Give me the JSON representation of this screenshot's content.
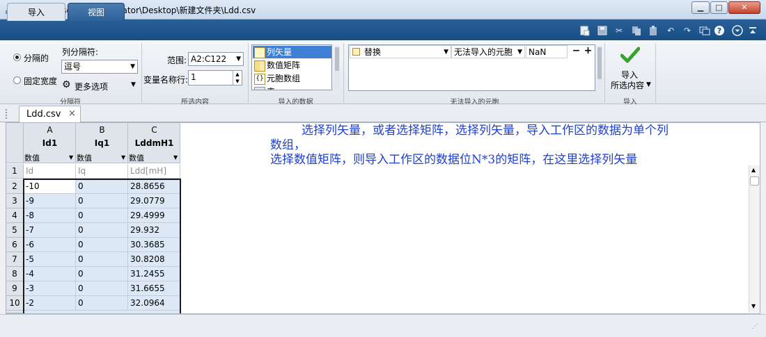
{
  "window": {
    "title": "导入 - C:\\Users\\Administrator\\Desktop\\新建文件夹\\Ldd.csv",
    "minimize_glyph": "▁",
    "maximize_glyph": "□",
    "close_glyph": "✕"
  },
  "tabs": [
    {
      "label": "导入",
      "active": true
    },
    {
      "label": "视图",
      "active": false
    }
  ],
  "quick_access_icons": [
    "new-icon",
    "save-icon",
    "cut-icon",
    "copy-icon",
    "paste-icon",
    "undo-icon",
    "redo-icon",
    "switch-windows-icon",
    "help-icon",
    "minimize-toolstrip-icon",
    "collapse-icon"
  ],
  "toolstrip": {
    "delimiters": {
      "radio_delimited": "分隔的",
      "radio_fixed_width": "固定宽度",
      "column_delimiter_label": "列分隔符:",
      "column_delimiter_value": "逗号",
      "more_options": "更多选项",
      "section_label": "分隔符"
    },
    "selection": {
      "range_label": "范围:",
      "range_value": "A2:C122",
      "var_names_row_label": "变量名称行:",
      "var_names_row_value": "1",
      "section_label": "所选内容"
    },
    "output_type": {
      "options": [
        "列矢量",
        "数值矩阵",
        "元胞数组",
        "表"
      ],
      "selected": "列矢量",
      "section_label": "导入的数据"
    },
    "unimportable": {
      "rule_action": "替换",
      "rule_target": "无法导入的元胞",
      "replacement_value": "NaN",
      "remove_glyph": "−",
      "add_glyph": "+",
      "section_label": "无法导入的元胞"
    },
    "import": {
      "button_line1": "导入",
      "button_line2": "所选内容",
      "section_label": "导入"
    }
  },
  "document_tab": {
    "label": "Ldd.csv",
    "close_glyph": "×"
  },
  "grid": {
    "columns": [
      {
        "letter": "A",
        "var_name": "Id1",
        "type": "数值",
        "header_cell": "Id"
      },
      {
        "letter": "B",
        "var_name": "Iq1",
        "type": "数值",
        "header_cell": "Iq"
      },
      {
        "letter": "C",
        "var_name": "LddmH1",
        "type": "数值",
        "header_cell": "Ldd[mH]"
      }
    ],
    "rows": [
      {
        "num": "2",
        "cells": [
          "-10",
          "0",
          "28.8656"
        ]
      },
      {
        "num": "3",
        "cells": [
          "-9",
          "0",
          "29.0779"
        ]
      },
      {
        "num": "4",
        "cells": [
          "-8",
          "0",
          "29.4999"
        ]
      },
      {
        "num": "5",
        "cells": [
          "-7",
          "0",
          "29.932"
        ]
      },
      {
        "num": "6",
        "cells": [
          "-6",
          "0",
          "30.3685"
        ]
      },
      {
        "num": "7",
        "cells": [
          "-5",
          "0",
          "30.8208"
        ]
      },
      {
        "num": "8",
        "cells": [
          "-4",
          "0",
          "31.2455"
        ]
      },
      {
        "num": "9",
        "cells": [
          "-3",
          "0",
          "31.6655"
        ]
      },
      {
        "num": "10",
        "cells": [
          "-2",
          "0",
          "32.0964"
        ]
      }
    ],
    "header_row_num": "1"
  },
  "annotation": {
    "line1": "选择列矢量，或者选择矩阵，选择列矢量，导入工作区的数据为单个列",
    "line2": "数组，",
    "line3": "选择数值矩阵，则导入工作区的数据位N*3的矩阵，在这里选择列矢量"
  },
  "colors": {
    "selection_blue": "#dce8f5",
    "tab_strip": "#1d5288",
    "annotation_blue": "#1f3fce",
    "import_check_green": "#3aa030"
  }
}
